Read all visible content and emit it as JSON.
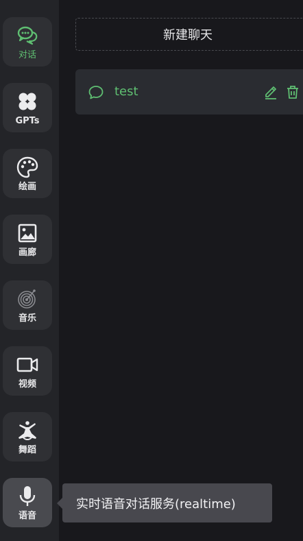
{
  "sidebar": {
    "items": [
      {
        "label": "对话",
        "icon": "chat-bubbles-icon",
        "active": true
      },
      {
        "label": "GPTs",
        "icon": "gpts-grid-icon"
      },
      {
        "label": "绘画",
        "icon": "palette-icon"
      },
      {
        "label": "画廊",
        "icon": "gallery-image-icon"
      },
      {
        "label": "音乐",
        "icon": "music-disc-icon"
      },
      {
        "label": "视频",
        "icon": "video-camera-icon"
      },
      {
        "label": "舞蹈",
        "icon": "dance-icon"
      },
      {
        "label": "语音",
        "icon": "microphone-icon",
        "hovered": true
      }
    ]
  },
  "main": {
    "new_chat_label": "新建聊天",
    "sessions": [
      {
        "title": "test"
      }
    ]
  },
  "tooltip": {
    "text": "实时语音对话服务(realtime)"
  },
  "colors": {
    "accent": "#5fbf72",
    "sidebar_bg": "#232428",
    "main_bg": "#18181c",
    "item_bg": "#2f3034",
    "session_bg": "#2a2c31",
    "tooltip_bg": "#48484e"
  }
}
